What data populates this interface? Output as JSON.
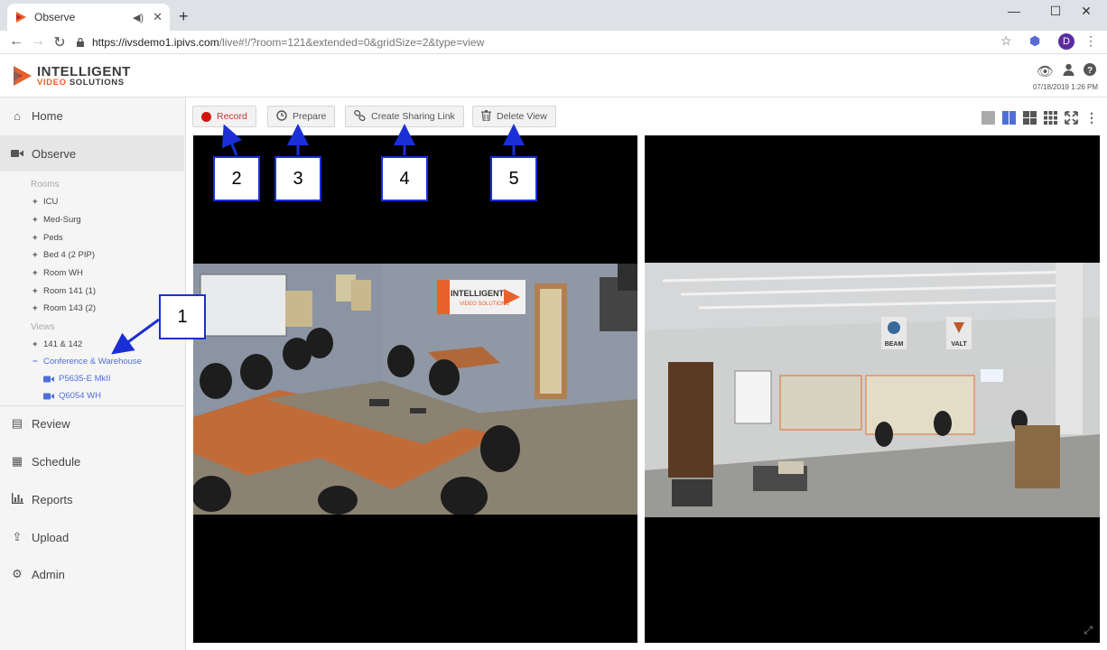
{
  "browser": {
    "tab_title": "Observe",
    "url_host": "https://ivsdemo1.ipivs.com",
    "url_path": "/live#!/?room=121&extended=0&gridSize=2&type=view",
    "profile_initial": "D"
  },
  "header": {
    "logo_line1": "INTELLIGENT",
    "logo_line2_a": "VIDEO",
    "logo_line2_b": "SOLUTIONS",
    "datetime": "07/18/2019 1:26 PM"
  },
  "sidebar": {
    "nav": [
      {
        "label": "Home",
        "icon": "home-icon"
      },
      {
        "label": "Observe",
        "icon": "video-camera-icon"
      },
      {
        "label": "Review",
        "icon": "film-icon"
      },
      {
        "label": "Schedule",
        "icon": "calendar-icon"
      },
      {
        "label": "Reports",
        "icon": "bar-chart-icon"
      },
      {
        "label": "Upload",
        "icon": "upload-icon"
      },
      {
        "label": "Admin",
        "icon": "gear-icon"
      }
    ],
    "rooms_heading": "Rooms",
    "rooms": [
      "ICU",
      "Med-Surg",
      "Peds",
      "Bed 4 (2 PIP)",
      "Room WH",
      "Room 141 (1)",
      "Room 143 (2)"
    ],
    "views_heading": "Views",
    "views": [
      {
        "label": "141 & 142",
        "expanded": false
      },
      {
        "label": "Conference & Warehouse",
        "expanded": true
      }
    ],
    "cameras": [
      "P5635-E MkII",
      "Q6054 WH"
    ]
  },
  "actions": {
    "record": "Record",
    "prepare": "Prepare",
    "share": "Create Sharing Link",
    "delete": "Delete View"
  },
  "callouts": [
    "1",
    "2",
    "3",
    "4",
    "5"
  ],
  "colors": {
    "accent": "#4f6fd8",
    "record": "#d0140c",
    "callout_border": "#1a2fd6",
    "logo_orange": "#e8602b"
  }
}
